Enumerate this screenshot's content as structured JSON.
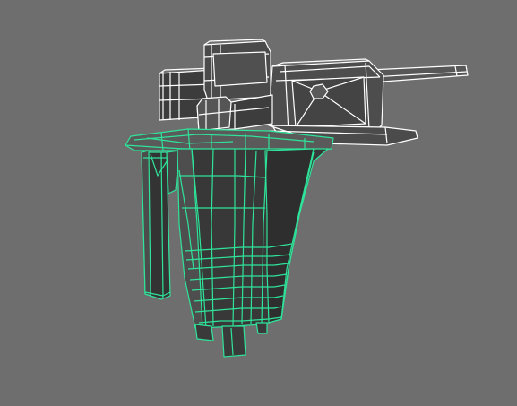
{
  "viewport": {
    "background": "#6e6e6e",
    "wireframe_color": "#ffffff",
    "selected_wireframe_color": "#2fe39a",
    "shading_dark": "#3a3a3a",
    "shading_light": "#555555"
  }
}
